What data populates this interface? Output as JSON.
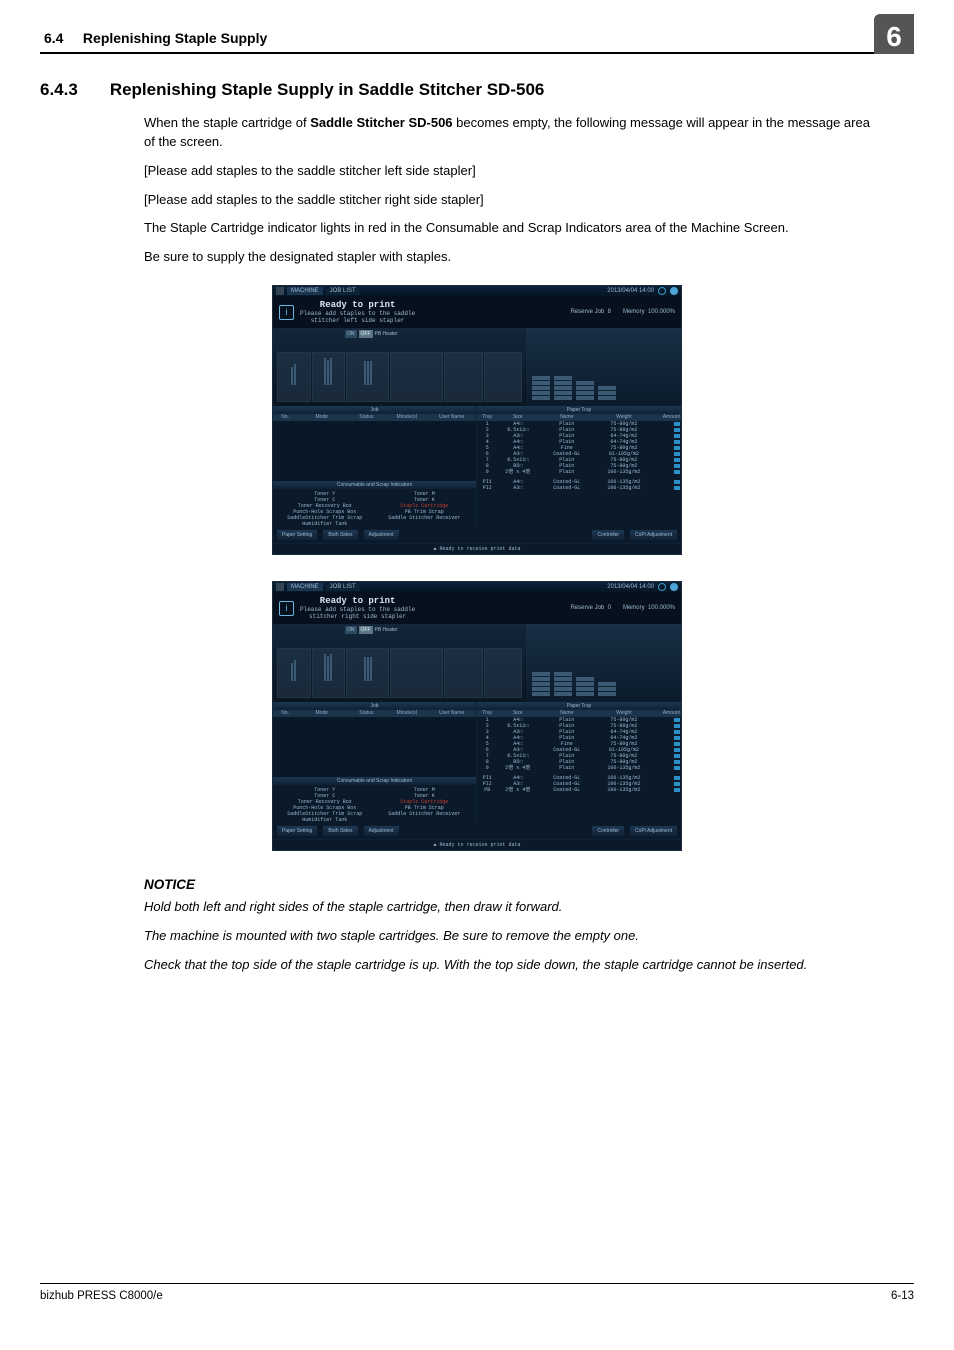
{
  "runhead": {
    "section_num": "6.4",
    "section_title": "Replenishing Staple Supply",
    "chapter_num": "6"
  },
  "heading": {
    "num": "6.4.3",
    "title": "Replenishing Staple Supply in Saddle Stitcher SD-506"
  },
  "p_intro_1": "When the staple cartridge of ",
  "p_intro_bold": "Saddle Stitcher SD-506",
  "p_intro_2": " becomes empty, the following message will appear in the message area of the screen.",
  "msg_left": "[Please add staples to the saddle stitcher left side stapler]",
  "msg_right": "[Please add staples to the saddle stitcher right side stapler]",
  "p_indicator": "The Staple Cartridge indicator lights in red in the Consumable and Scrap Indicators area of the Machine Screen.",
  "p_besure": "Be sure to supply the designated stapler with staples.",
  "screen": {
    "tab_machine": "MACHINE",
    "tab_joblist": "JOB LIST",
    "clock": "2013/04/04 14:00",
    "info_glyph": "i",
    "ready": "Ready to print",
    "sub_left": "Please add staples to the saddle\nstitcher left side stapler",
    "sub_right": "Please add staples to the saddle\nstitcher right side stapler",
    "reserve": "Reserve Job",
    "reserve_n1": "8",
    "reserve_n2": "0",
    "memory": "Memory",
    "memory_pct": "100.000%",
    "heater_on": "ON",
    "heater_off": "OFF",
    "heater_lbl": "PB Heater",
    "tab_job": "Job",
    "tab_paper": "Paper Tray",
    "jobhead": {
      "c1": "No.",
      "c2": "Mode",
      "c3": "Status",
      "c4": "Minute(s)",
      "c5": "User Name"
    },
    "consum_title": "Consumable and Scrap Indicators",
    "cons_lines": [
      [
        "Toner Y",
        "Toner M"
      ],
      [
        "Toner C",
        "Toner K"
      ],
      [
        "Toner Recovery Box",
        "Staple Cartridge"
      ],
      [
        "Punch-Hole Scraps Box",
        "PB Trim Scrap"
      ],
      [
        "SaddleStitcher Trim Scrap",
        "Saddle Stitcher Receiver"
      ],
      [
        "Humidifier Tank",
        ""
      ]
    ],
    "btn_paper": "Paper Setting",
    "btn_both": "Both Sides",
    "btn_adj": "Adjustment",
    "btn_ctrl": "Controller",
    "btn_copi": "CoPi Adjustment",
    "statusline": "Ready to receive print data",
    "paperhead": {
      "c1": "Tray",
      "c2": "Size",
      "c3": "Name",
      "c4": "Weight",
      "c5": "Amount"
    },
    "trays1": [
      {
        "n": "1",
        "size": "A4□",
        "name": "Plain",
        "wt": "75-80g/m2"
      },
      {
        "n": "2",
        "size": "8.5x11□",
        "name": "Plain",
        "wt": "75-80g/m2"
      },
      {
        "n": "3",
        "size": "A3□",
        "name": "Plain",
        "wt": "64-74g/m2"
      },
      {
        "n": "4",
        "size": "A4□",
        "name": "Plain",
        "wt": "64-74g/m2"
      },
      {
        "n": "5",
        "size": "A4□",
        "name": "Fine",
        "wt": "75-80g/m2"
      },
      {
        "n": "6",
        "size": "A3□",
        "name": "Coated-GL",
        "wt": "81-105g/m2"
      },
      {
        "n": "7",
        "size": "8.5x11□",
        "name": "Plain",
        "wt": "75-80g/m2"
      },
      {
        "n": "8",
        "size": "B5□",
        "name": "Plain",
        "wt": "75-80g/m2"
      },
      {
        "n": "9",
        "size": "2倍 x 4倍",
        "name": "Plain",
        "wt": "106-135g/m2"
      }
    ],
    "pi1": [
      {
        "n": "PI1",
        "size": "A4□",
        "name": "Coated-GL",
        "wt": "106-135g/m2"
      },
      {
        "n": "PI2",
        "size": "A3□",
        "name": "Coated-GL",
        "wt": "106-135g/m2"
      }
    ],
    "trays2": [
      {
        "n": "1",
        "size": "A4□",
        "name": "Plain",
        "wt": "75-80g/m2"
      },
      {
        "n": "2",
        "size": "8.5x11□",
        "name": "Plain",
        "wt": "75-80g/m2"
      },
      {
        "n": "3",
        "size": "A3□",
        "name": "Plain",
        "wt": "64-74g/m2"
      },
      {
        "n": "4",
        "size": "A4□",
        "name": "Plain",
        "wt": "64-74g/m2"
      },
      {
        "n": "5",
        "size": "A4□",
        "name": "Fine",
        "wt": "75-80g/m2"
      },
      {
        "n": "6",
        "size": "A3□",
        "name": "Coated-GL",
        "wt": "81-105g/m2"
      },
      {
        "n": "7",
        "size": "8.5x11□",
        "name": "Plain",
        "wt": "75-80g/m2"
      },
      {
        "n": "8",
        "size": "B5□",
        "name": "Plain",
        "wt": "75-80g/m2"
      },
      {
        "n": "9",
        "size": "2倍 x 4倍",
        "name": "Plain",
        "wt": "106-135g/m2"
      }
    ],
    "pi2": [
      {
        "n": "PI1",
        "size": "A4□",
        "name": "Coated-GL",
        "wt": "106-135g/m2"
      },
      {
        "n": "PI2",
        "size": "A3□",
        "name": "Coated-GL",
        "wt": "106-135g/m2"
      },
      {
        "n": "PB",
        "size": "2倍 x 4倍",
        "name": "Coated-GL",
        "wt": "106-135g/m2"
      }
    ]
  },
  "notice": {
    "h": "NOTICE",
    "l1": "Hold both left and right sides of the staple cartridge, then draw it forward.",
    "l2": "The machine is mounted with two staple cartridges. Be sure to remove the empty one.",
    "l3": "Check that the top side of the staple cartridge is up. With the top side down, the staple cartridge cannot be inserted."
  },
  "footer": {
    "product": "bizhub PRESS C8000/e",
    "page": "6-13"
  }
}
